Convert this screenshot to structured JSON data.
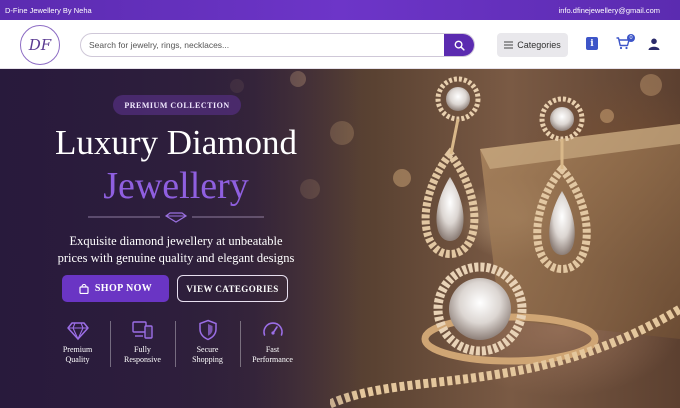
{
  "topbar": {
    "brand": "D-Fine Jewellery By Neha",
    "email": "info.dfinejewellery@gmail.com"
  },
  "header": {
    "logo_text": "DF",
    "search_placeholder": "Search for jewelry, rings, necklaces...",
    "categories_label": "Categories",
    "cart_count": "0",
    "icons": [
      "search-icon",
      "list-icon",
      "info-icon",
      "cart-icon",
      "user-icon"
    ]
  },
  "hero": {
    "badge": "PREMIUM COLLECTION",
    "title_line1": "Luxury Diamond",
    "title_line2": "Jewellery",
    "description_line1": "Exquisite diamond jewellery at unbeatable",
    "description_line2": "prices with genuine quality and elegant designs",
    "shop_label": "SHOP NOW",
    "view_label": "VIEW CATEGORIES",
    "features": [
      {
        "line1": "Premium",
        "line2": "Quality",
        "icon": "diamond-icon"
      },
      {
        "line1": "Fully",
        "line2": "Responsive",
        "icon": "devices-icon"
      },
      {
        "line1": "Secure",
        "line2": "Shopping",
        "icon": "shield-icon"
      },
      {
        "line1": "Fast",
        "line2": "Performance",
        "icon": "speedometer-icon"
      }
    ]
  },
  "colors": {
    "brand_purple": "#5b2bb0",
    "accent_purple": "#8f5fe0",
    "badge_blue": "#3d55c8"
  }
}
